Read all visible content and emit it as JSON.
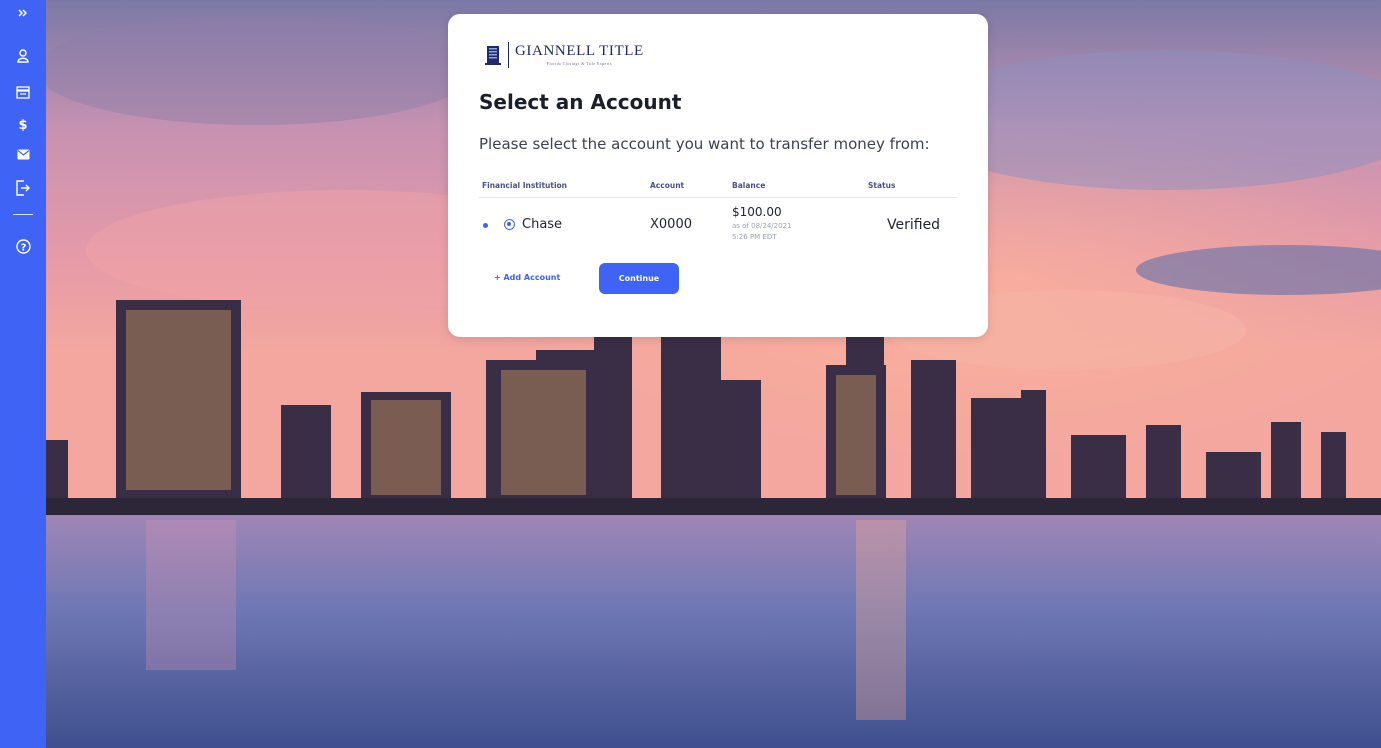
{
  "logo": {
    "name": "GIANNELL TITLE",
    "tagline": "Florida Closings & Title Experts"
  },
  "page": {
    "title": "Select an Account",
    "subtitle": "Please select the account you want to transfer money from:"
  },
  "table": {
    "headers": [
      "Financial Institution",
      "Account",
      "Balance",
      "Status"
    ],
    "rows": [
      {
        "institution": "Chase",
        "account": "X0000",
        "balance": "$100.00",
        "as_of": "as of 08/24/2021\n5:26 PM EDT",
        "status": "Verified",
        "selected": true
      }
    ]
  },
  "actions": {
    "add_account": "+ Add Account",
    "continue": "Continue"
  },
  "sidebar": {
    "items": [
      {
        "icon": "expand-chevrons-icon"
      },
      {
        "icon": "user-icon"
      },
      {
        "icon": "wallet-icon"
      },
      {
        "icon": "dollar-icon"
      },
      {
        "icon": "mail-icon"
      },
      {
        "icon": "logout-icon"
      },
      {
        "icon": "help-icon"
      }
    ]
  },
  "colors": {
    "accent": "#3f63f5",
    "sidebar": "#3f63f5",
    "title": "#1b1f2c",
    "logo": "#1f2a6e"
  }
}
